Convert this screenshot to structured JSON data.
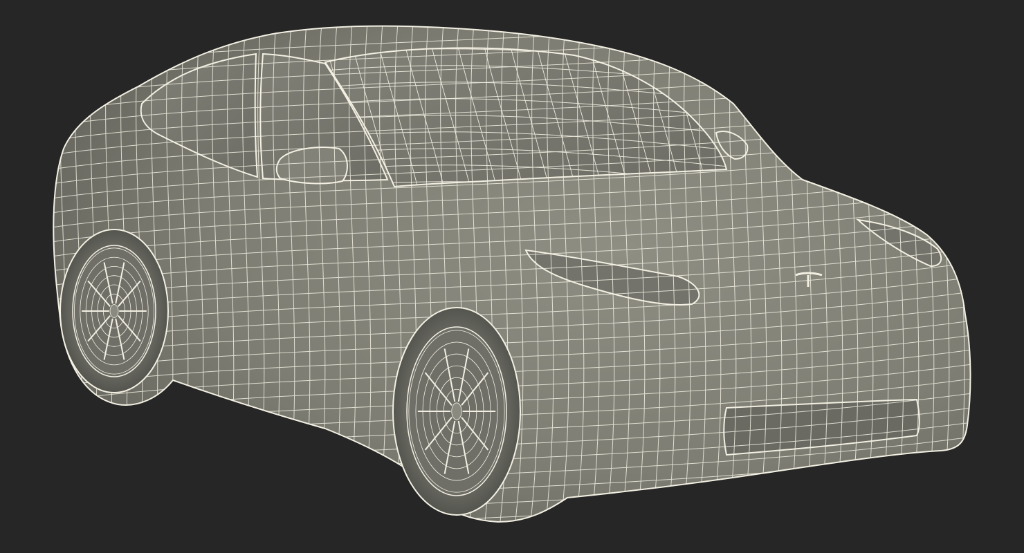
{
  "scene": {
    "subject": "wireframe-car-model",
    "render_style": "wireframe-over-shaded",
    "background_color": "#262626",
    "body_color": "#8a8a7e",
    "body_shadow_color": "#5f5f57",
    "glass_color": "#7c7c72",
    "tire_color": "#6d6d66",
    "wire_color": "#f3f0e3",
    "logo": "t-emblem"
  }
}
